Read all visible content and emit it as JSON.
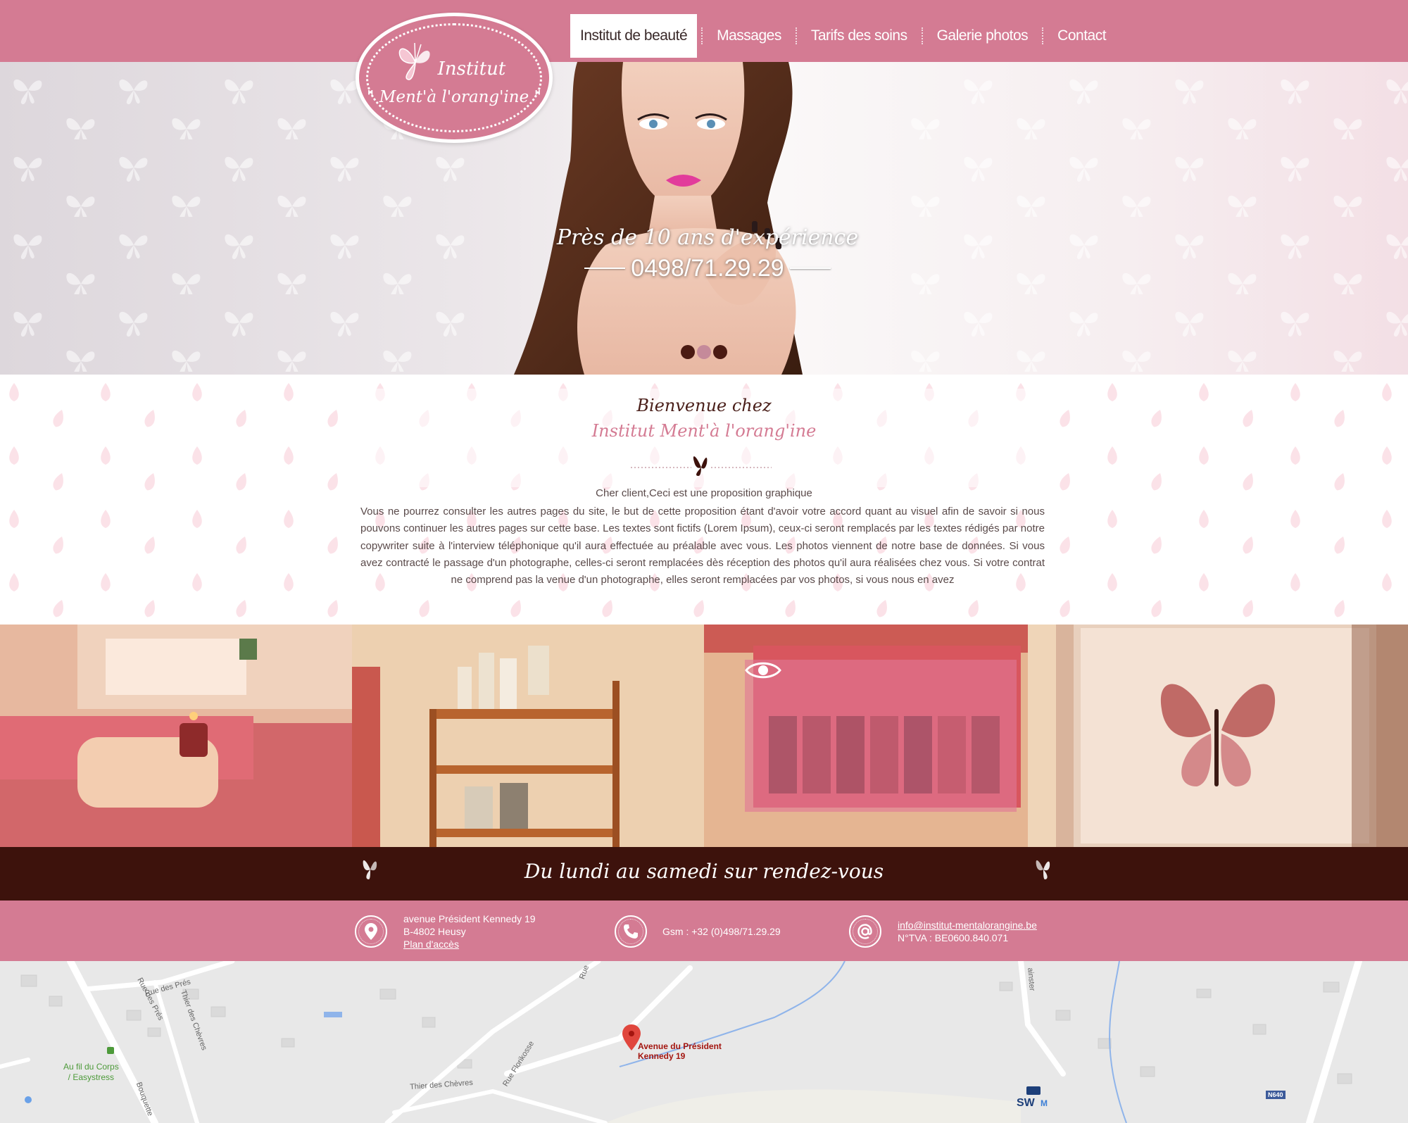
{
  "nav": {
    "items": [
      {
        "label": "Institut de beauté",
        "active": true
      },
      {
        "label": "Massages"
      },
      {
        "label": "Tarifs des soins"
      },
      {
        "label": "Galerie photos"
      },
      {
        "label": "Contact"
      }
    ]
  },
  "logo": {
    "line1": "Institut",
    "line2": "\" Ment'à l'orang'ine \"",
    "icon": "butterfly-icon"
  },
  "hero": {
    "title": "Près de 10 ans d'expérience",
    "phone": "0498/71.29.29",
    "slides_active_index": 1,
    "slides_count": 3
  },
  "welcome": {
    "title1": "Bienvenue chez",
    "title2": "Institut Ment'à l'orang'ine",
    "lead": "Cher client,Ceci est  une proposition graphique",
    "body": "Vous ne pourrez consulter les autres pages du site, le but de cette proposition étant d'avoir votre accord quant au visuel afin de savoir si nous pouvons continuer les autres pages sur cette base. Les textes sont fictifs (Lorem Ipsum), ceux-ci seront remplacés par les textes rédigés par notre copywriter suite à l'interview téléphonique qu'il aura effectuée au préalable avec vous. Les photos viennent de notre base de données. Si vous avez contracté le passage d'un photographe, celles-ci seront remplacées dès réception des photos qu'il aura réalisées chez vous. Si votre contrat ne comprend pas la venue d'un photographe, elles seront remplacées par vos photos, si vous nous en avez"
  },
  "gallery": {
    "items": [
      "massage-table-photo",
      "shelf-products-photo",
      "nail-polish-photo",
      "butterfly-frame-photo"
    ],
    "hover_icon": "eye-icon"
  },
  "hours": {
    "text": "Du lundi au samedi sur rendez-vous"
  },
  "contact": {
    "address_line1": "avenue Président Kennedy 19",
    "address_line2": "B-4802 Heusy",
    "map_link": "Plan d'accès",
    "phone": "Gsm : +32 (0)498/71.29.29",
    "email": "info@institut-mentalorangine.be",
    "vat": "N°TVA : BE0600.840.071"
  },
  "map": {
    "pin_label_line1": "Avenue du Président",
    "pin_label_line2": "Kennedy 19",
    "poi_line1": "Au fil du Corps",
    "poi_line2": "/ Easystress",
    "streets": [
      "Rue des Prés",
      "Rue des Prés",
      "Thier des Chèvres",
      "Rue Florikosse",
      "Thier des Chèvres",
      "Bouquette",
      "Rue",
      "ainster"
    ],
    "road_badge": "N640",
    "brand": "SWM"
  },
  "colors": {
    "brand_pink": "#d47b93",
    "dark_brown": "#3d120c",
    "white": "#ffffff"
  }
}
